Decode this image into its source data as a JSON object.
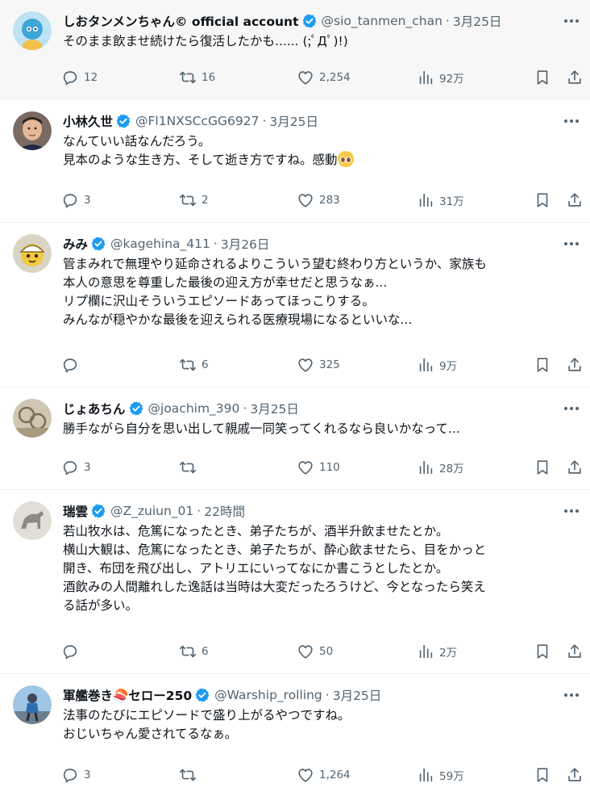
{
  "tweets": [
    {
      "name": "しおタンメンちゃん© official account",
      "handle": "@sio_tanmen_chan",
      "sep": "·",
      "time": "3月25日",
      "lines": [
        "そのまま飲ませ続けたら復活したかも...... (;ﾟДﾟ)!)"
      ],
      "replies": "12",
      "retweets": "16",
      "likes": "2,254",
      "views": "92万",
      "avatar_color": "#3da7d8"
    },
    {
      "name": "小林久世",
      "handle": "@Fl1NXSCcGG6927",
      "sep": "·",
      "time": "3月25日",
      "lines": [
        "なんていい話なんだろう。",
        "見本のような生き方、そして逝き方ですね。感動"
      ],
      "replies": "3",
      "retweets": "2",
      "likes": "283",
      "views": "31万",
      "avatar_color": "#8a6d5a"
    },
    {
      "name": "みみ",
      "handle": "@kagehina_411",
      "sep": "·",
      "time": "3月26日",
      "lines": [
        "管まみれで無理やり延命されるよりこういう望む終わり方というか、家族も",
        "本人の意思を尊重した最後の迎え方が幸せだと思うなぁ...",
        "リプ欄に沢山そういうエピソードあってほっこりする。",
        "みんなが穏やかな最後を迎えられる医療現場になるといいな..."
      ],
      "replies": "",
      "retweets": "6",
      "likes": "325",
      "views": "9万",
      "avatar_color": "#e8c34a"
    },
    {
      "name": "じょあちん",
      "handle": "@joachim_390",
      "sep": "·",
      "time": "3月25日",
      "lines": [
        "勝手ながら自分を思い出して親戚一同笑ってくれるなら良いかなって..."
      ],
      "replies": "3",
      "retweets": "",
      "likes": "110",
      "views": "28万",
      "avatar_color": "#b9a98c"
    },
    {
      "name": "瑞雲",
      "handle": "@Z_zuiun_01",
      "sep": "·",
      "time": "22時間",
      "lines": [
        "若山牧水は、危篤になったとき、弟子たちが、酒半升飲ませたとか。",
        "横山大観は、危篤になったとき、弟子たちが、酔心飲ませたら、目をかっと",
        "開き、布団を飛び出し、アトリエにいってなにか書こうとしたとか。",
        "酒飲みの人間離れした逸話は当時は大変だったろうけど、今となったら笑え",
        "る話が多い。"
      ],
      "replies": "",
      "retweets": "6",
      "likes": "50",
      "views": "2万",
      "avatar_color": "#c9c3b5"
    },
    {
      "name": "軍艦巻き🍣セロー250",
      "handle": "@Warship_rolling",
      "sep": "·",
      "time": "3月25日",
      "lines": [
        "法事のたびにエピソードで盛り上がるやつですね。",
        "おじいちゃん愛されてるなぁ。"
      ],
      "replies": "3",
      "retweets": "",
      "likes": "1,264",
      "views": "59万",
      "avatar_color": "#4a90c8"
    }
  ],
  "colors": {
    "verified": "#1d9bf0",
    "muted": "#536471",
    "text": "#0f1419",
    "highlight_bg": "#f7f7f7"
  }
}
